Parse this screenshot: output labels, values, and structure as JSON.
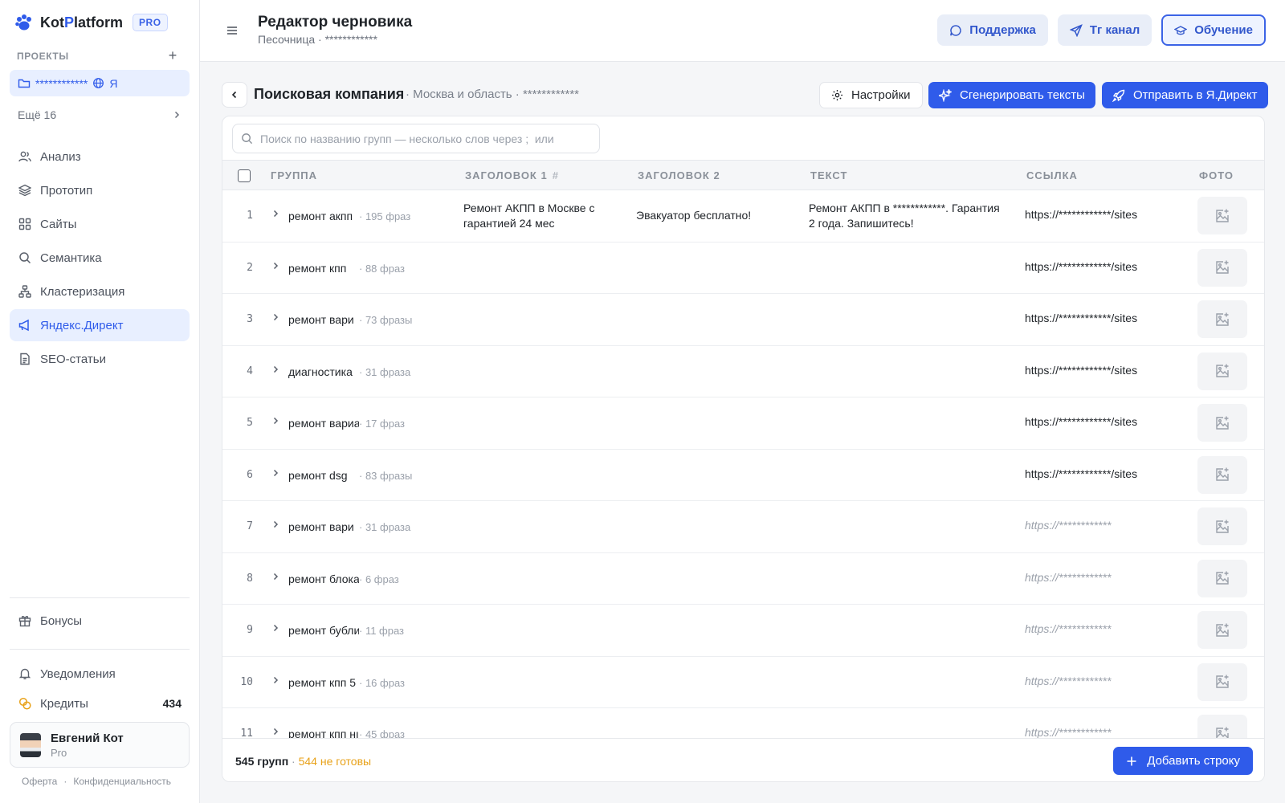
{
  "sidebar": {
    "logo_prefix": "Kot",
    "logo_accent": "P",
    "logo_suffix": "latform",
    "pro_badge": "PRO",
    "projects_label": "ПРОЕКТЫ",
    "project_name": "************",
    "project_lang": "Я",
    "more_label": "Ещё 16",
    "nav": [
      {
        "label": "Анализ",
        "icon": "users-icon"
      },
      {
        "label": "Прототип",
        "icon": "layers-icon"
      },
      {
        "label": "Сайты",
        "icon": "grid-icon"
      },
      {
        "label": "Семантика",
        "icon": "search-icon"
      },
      {
        "label": "Кластеризация",
        "icon": "cluster-icon"
      },
      {
        "label": "Яндекс.Директ",
        "icon": "megaphone-icon",
        "active": true
      },
      {
        "label": "SEO-статьи",
        "icon": "document-icon"
      }
    ],
    "bonuses": "Бонусы",
    "notifications": "Уведомления",
    "credits_label": "Кредиты",
    "credits_value": "434",
    "user": {
      "name": "Евгений Кот",
      "plan": "Pro"
    },
    "legal": {
      "offer": "Оферта",
      "sep": "·",
      "privacy": "Конфиденциальность"
    }
  },
  "header": {
    "title": "Редактор черновика",
    "subtitle": "Песочница · ************",
    "buttons": {
      "support": "Поддержка",
      "tg": "Tг канал",
      "learn": "Обучение"
    }
  },
  "campaign": {
    "title": "Поисковая компания",
    "meta": "· Москва и область · ************",
    "settings": "Настройки",
    "generate": "Сгенерировать тексты",
    "send": "Отправить в Я.Директ"
  },
  "table": {
    "search_placeholder": "Поиск по названию групп — несколько слов через ;  или",
    "columns": {
      "group": "ГРУППА",
      "h1": "ЗАГОЛОВОК 1",
      "hash": "#",
      "h2": "ЗАГОЛОВОК 2",
      "text": "ТЕКСТ",
      "link": "ССЫЛКА",
      "photo": "ФОТО"
    },
    "rows": [
      {
        "num": "1",
        "group": "ремонт акпп",
        "count": "· 195 фраз",
        "h1": "Ремонт АКПП в Москве с гарантией 24 мес",
        "h2": "Эвакуатор бесплатно!",
        "text": "Ремонт АКПП в ************. Гарантия 2 года. Запишитесь!",
        "link": "https://************/sites",
        "link_placeholder": false
      },
      {
        "num": "2",
        "group": "ремонт кпп",
        "count": "· 88 фраз",
        "h1": "",
        "h2": "",
        "text": "",
        "link": "https://************/sites",
        "link_placeholder": false
      },
      {
        "num": "3",
        "group": "ремонт вари",
        "count": "· 73 фразы",
        "h1": "",
        "h2": "",
        "text": "",
        "link": "https://************/sites",
        "link_placeholder": false
      },
      {
        "num": "4",
        "group": "диагностика",
        "count": "· 31 фраза",
        "h1": "",
        "h2": "",
        "text": "",
        "link": "https://************/sites",
        "link_placeholder": false
      },
      {
        "num": "5",
        "group": "ремонт вариа",
        "count": "· 17 фраз",
        "h1": "",
        "h2": "",
        "text": "",
        "link": "https://************/sites",
        "link_placeholder": false
      },
      {
        "num": "6",
        "group": "ремонт dsg",
        "count": "· 83 фразы",
        "h1": "",
        "h2": "",
        "text": "",
        "link": "https://************/sites",
        "link_placeholder": false
      },
      {
        "num": "7",
        "group": "ремонт вари",
        "count": "· 31 фраза",
        "h1": "",
        "h2": "",
        "text": "",
        "link": "https://************",
        "link_placeholder": true
      },
      {
        "num": "8",
        "group": "ремонт блока а",
        "count": "· 6 фраз",
        "h1": "",
        "h2": "",
        "text": "",
        "link": "https://************",
        "link_placeholder": true
      },
      {
        "num": "9",
        "group": "ремонт бублик",
        "count": "· 11 фраз",
        "h1": "",
        "h2": "",
        "text": "",
        "link": "https://************",
        "link_placeholder": true
      },
      {
        "num": "10",
        "group": "ремонт кпп 5",
        "count": "· 16 фраз",
        "h1": "",
        "h2": "",
        "text": "",
        "link": "https://************",
        "link_placeholder": true
      },
      {
        "num": "11",
        "group": "ремонт кпп нı",
        "count": "· 45 фраз",
        "h1": "",
        "h2": "",
        "text": "",
        "link": "https://************",
        "link_placeholder": true
      }
    ],
    "footer": {
      "groups": "545 групп",
      "sep": "·",
      "not_ready": "544 не готовы",
      "add_row": "Добавить строку"
    }
  },
  "colors": {
    "accent": "#2f5bea",
    "warning": "#e8a21a",
    "active_bg": "#e8efff"
  }
}
